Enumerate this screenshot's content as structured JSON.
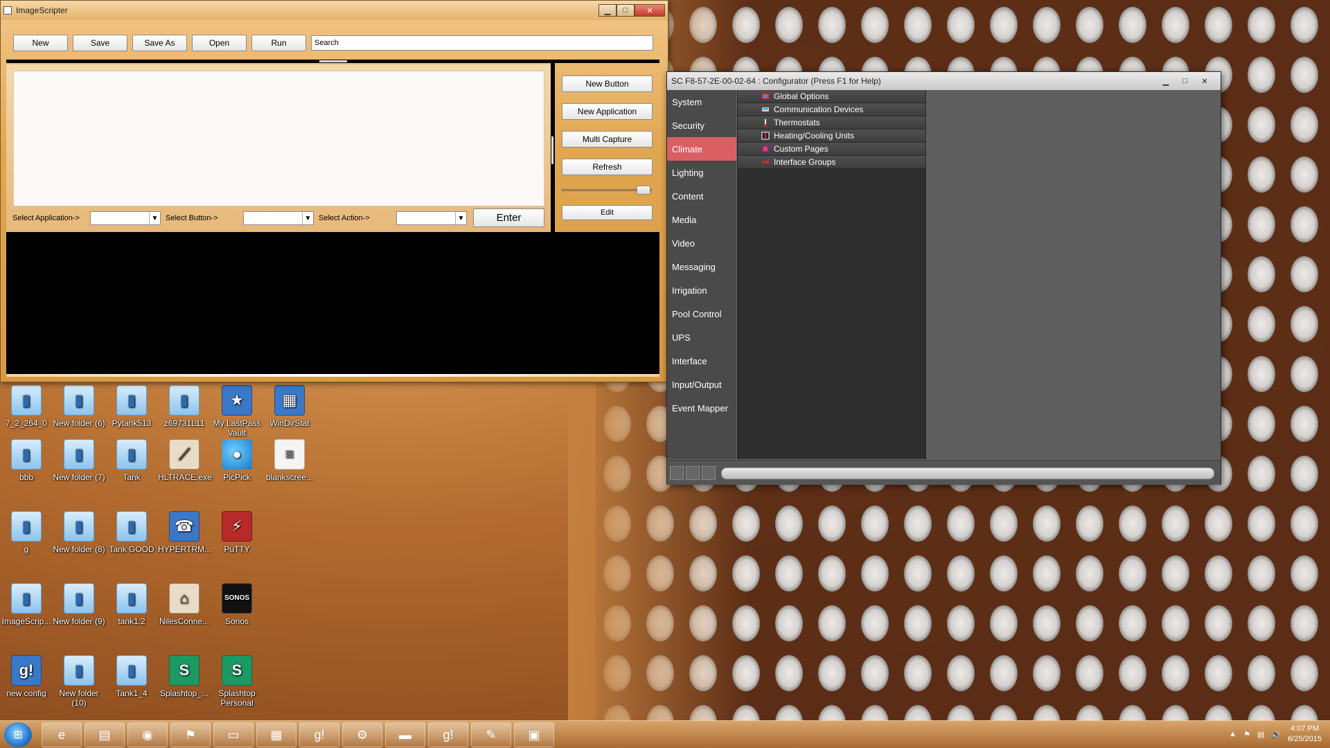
{
  "imagescripter": {
    "title": "ImageScripter",
    "toolbar": {
      "new": "New",
      "save": "Save",
      "save_as": "Save As",
      "open": "Open",
      "run": "Run",
      "search_value": "Search"
    },
    "side_buttons": {
      "new_button": "New Button",
      "new_application": "New Application",
      "multi_capture": "Multi Capture",
      "refresh": "Refresh",
      "edit": "Edit"
    },
    "selectors": {
      "select_application": "Select Application->",
      "select_button": "Select Button->",
      "select_action": "Select Action->",
      "enter": "Enter"
    }
  },
  "configurator": {
    "title": "SC F8-57-2E-00-02-64 : Configurator   (Press F1 for Help)",
    "nav": [
      "System",
      "Security",
      "Climate",
      "Lighting",
      "Content",
      "Media",
      "Video",
      "Messaging",
      "Irrigation",
      "Pool Control",
      "UPS",
      "Interface",
      "Input/Output",
      "Event Mapper"
    ],
    "active_nav": "Climate",
    "tree_items": [
      "Global Options",
      "Communication Devices",
      "Thermostats",
      "Heating/Cooling Units",
      "Custom Pages",
      "Interface Groups"
    ]
  },
  "desktop_icons": [
    {
      "label": "7_2_264_0",
      "icon": "folder-icon"
    },
    {
      "label": "New folder (6)",
      "icon": "folder-icon"
    },
    {
      "label": "Pytank513",
      "icon": "folder-icon"
    },
    {
      "label": "z69731L11",
      "icon": "folder-icon"
    },
    {
      "label": "My LastPass Vault",
      "icon": "lastpass-icon"
    },
    {
      "label": "WinDirStat",
      "icon": "windirstat-icon"
    },
    {
      "label": "bbb",
      "icon": "folder-icon"
    },
    {
      "label": "New folder (7)",
      "icon": "folder-icon"
    },
    {
      "label": "Tank",
      "icon": "folder-icon"
    },
    {
      "label": "HLTRACE.exe",
      "icon": "exe-icon"
    },
    {
      "label": "PicPick",
      "icon": "picpick-icon"
    },
    {
      "label": "blankscree...",
      "icon": "file-icon"
    },
    {
      "label": "g",
      "icon": "folder-icon"
    },
    {
      "label": "New folder (8)",
      "icon": "folder-icon"
    },
    {
      "label": "Tank GOOD",
      "icon": "folder-icon"
    },
    {
      "label": "HYPERTRM...",
      "icon": "hyperterminal-icon"
    },
    {
      "label": "PuTTY",
      "icon": "putty-icon"
    },
    {
      "label": "ImageScrip...",
      "icon": "folder-icon"
    },
    {
      "label": "New folder (9)",
      "icon": "folder-icon"
    },
    {
      "label": "tank1.2",
      "icon": "folder-icon"
    },
    {
      "label": "NilesConne...",
      "icon": "niles-icon"
    },
    {
      "label": "Sonos",
      "icon": "sonos-icon"
    },
    {
      "label": "new config",
      "icon": "config-icon"
    },
    {
      "label": "New folder (10)",
      "icon": "folder-icon"
    },
    {
      "label": "Tank1_4",
      "icon": "folder-icon"
    },
    {
      "label": "Splashtop_...",
      "icon": "splashtop-icon"
    },
    {
      "label": "Splashtop Personal",
      "icon": "splashtop-icon"
    }
  ],
  "taskbar": {
    "apps": [
      "ie-icon",
      "explorer-icon",
      "chrome-icon",
      "acrobat-icon",
      "notepad-icon",
      "configurator-icon",
      "g-app-icon",
      "android-studio-icon",
      "terminal-icon",
      "g-app-icon-2",
      "imagescripter-icon",
      "window-icon"
    ],
    "time": "4:07 PM",
    "date": "6/25/2015"
  }
}
